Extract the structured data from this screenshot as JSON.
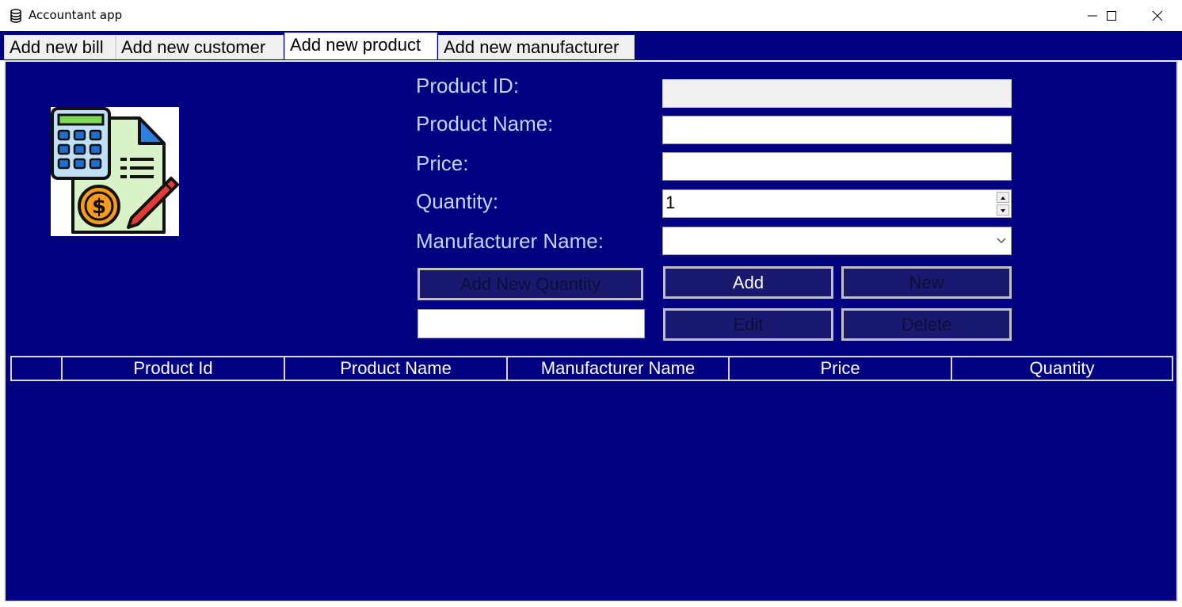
{
  "window": {
    "title": "Accountant app"
  },
  "tabs": [
    {
      "label": "Add new bill",
      "active": false
    },
    {
      "label": "Add new customer",
      "active": false
    },
    {
      "label": "Add new product",
      "active": true
    },
    {
      "label": "Add new manufacturer",
      "active": false
    }
  ],
  "form": {
    "labels": {
      "product_id": "Product ID:",
      "product_name": "Product Name:",
      "price": "Price:",
      "quantity": "Quantity:",
      "manufacturer_name": "Manufacturer Name:"
    },
    "values": {
      "product_id": "",
      "product_name": "",
      "price": "",
      "quantity": "1",
      "manufacturer_name": "",
      "new_quantity": ""
    }
  },
  "buttons": {
    "add_new_quantity": "Add New Quantity",
    "add": "Add",
    "new": "New",
    "edit": "Edit",
    "delete": "Delete"
  },
  "table": {
    "columns": [
      "",
      "Product Id",
      "Product Name",
      "Manufacturer Name",
      "Price",
      "Quantity"
    ],
    "rows": []
  },
  "colors": {
    "background": "#000080",
    "label": "#c7d3ff",
    "button_fill": "#191970",
    "button_border": "#c0c0c0"
  },
  "icons": {
    "app": "database-icon",
    "logo": "calculator-invoice-icon",
    "minimize": "minimize-icon",
    "maximize": "maximize-icon",
    "close": "close-icon"
  }
}
